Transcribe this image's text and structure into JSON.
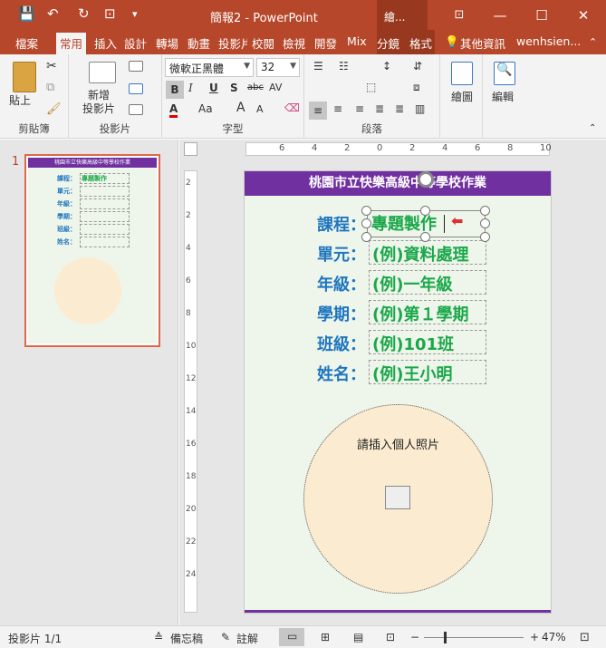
{
  "window": {
    "title": "簡報2 - PowerPoint",
    "context_tab_group": "繪...",
    "minimize": "—",
    "restore": "❐",
    "maximize": "☐",
    "close": "✕"
  },
  "quick_access": {
    "save": "💾",
    "undo": "↶",
    "redo": "↻",
    "present": "⊡",
    "more": "▾"
  },
  "tabs": [
    "檔案",
    "常用",
    "插入",
    "設計",
    "轉場",
    "動畫",
    "投影片",
    "校閱",
    "檢視",
    "開發",
    "Mix",
    "分鏡",
    "格式"
  ],
  "tell_me": "其他資訊",
  "user": "wenhsien...",
  "ribbon": {
    "clipboard": {
      "label": "剪貼簿",
      "paste": "貼上"
    },
    "slides": {
      "label": "投影片",
      "new_slide": "新增\n投影片"
    },
    "font": {
      "label": "字型",
      "font_name": "微軟正黑體",
      "font_size": "32",
      "bold": "B",
      "italic": "I",
      "underline": "U",
      "shadow": "S",
      "strike": "abc",
      "spacing": "AV",
      "case": "Aa",
      "grow": "A",
      "shrink": "A",
      "color": "A"
    },
    "paragraph": {
      "label": "段落"
    },
    "drawing": {
      "label": "繪圖"
    },
    "editing": {
      "label": "編輯"
    }
  },
  "thumbnail": {
    "number": "1",
    "title": "桃園市立快樂高級中等學校作業",
    "lines": [
      "課程：",
      "單元：",
      "年級：",
      "學期：",
      "班級：",
      "姓名："
    ],
    "course_value": "專題製作"
  },
  "ruler": {
    "h_ticks": [
      "6",
      "4",
      "2",
      "0",
      "2",
      "4",
      "6",
      "8",
      "10"
    ],
    "v_ticks": [
      "2",
      "2",
      "4",
      "6",
      "8",
      "10",
      "12",
      "14",
      "16",
      "18",
      "20",
      "22",
      "24"
    ]
  },
  "slide": {
    "header": "桃園市立快樂高級中等學校作業",
    "rows": [
      {
        "label": "課程：",
        "value": "專題製作"
      },
      {
        "label": "單元：",
        "value": "(例)資料處理"
      },
      {
        "label": "年級：",
        "value": "(例)一年級"
      },
      {
        "label": "學期：",
        "value": "(例)第１學期"
      },
      {
        "label": "班級：",
        "value": "(例)101班"
      },
      {
        "label": "姓名：",
        "value": "(例)王小明"
      }
    ],
    "photo_placeholder": "請插入個人照片"
  },
  "statusbar": {
    "slide_info": "投影片 1/1",
    "notes": "備忘稿",
    "comments": "註解",
    "zoom_out": "−",
    "zoom_in": "+",
    "zoom": "47%"
  },
  "colors": {
    "accent": "#b7472a",
    "header_purple": "#7030a0",
    "label_blue": "#1f76c0",
    "value_green": "#1aa84a"
  }
}
